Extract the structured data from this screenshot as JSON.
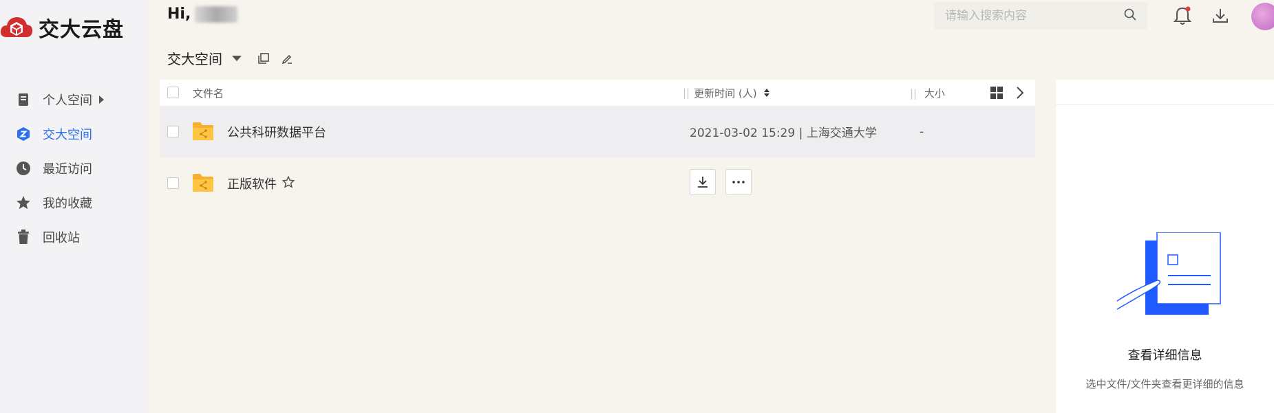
{
  "app": {
    "logo_text": "交大云盘",
    "brand_color": "#d12f2f",
    "accent_color": "#2a6ff0"
  },
  "header": {
    "greeting": "Hi,",
    "search_placeholder": "请输入搜索内容",
    "icons": [
      "bell-icon",
      "download-icon",
      "avatar"
    ]
  },
  "sidebar": {
    "items": [
      {
        "label": "个人空间",
        "icon": "document-icon",
        "active": false,
        "has_caret": true
      },
      {
        "label": "交大空间",
        "icon": "hexagon-z-icon",
        "active": true
      },
      {
        "label": "最近访问",
        "icon": "clock-icon",
        "active": false
      },
      {
        "label": "我的收藏",
        "icon": "star-icon",
        "active": false
      },
      {
        "label": "回收站",
        "icon": "trash-icon",
        "active": false
      }
    ]
  },
  "space": {
    "title": "交大空间"
  },
  "table": {
    "headers": {
      "name": "文件名",
      "time": "更新时间 (人)",
      "size": "大小"
    },
    "rows": [
      {
        "name": "公共科研数据平台",
        "time": "2021-03-02 15:29 | 上海交通大学",
        "size": "-",
        "highlighted": true
      },
      {
        "name": "正版软件",
        "time": "",
        "size": "",
        "highlighted": false,
        "actions": [
          "download-icon",
          "more-icon"
        ]
      }
    ]
  },
  "detail_panel": {
    "title": "查看详细信息",
    "subtitle": "选中文件/文件夹查看更详细的信息"
  }
}
